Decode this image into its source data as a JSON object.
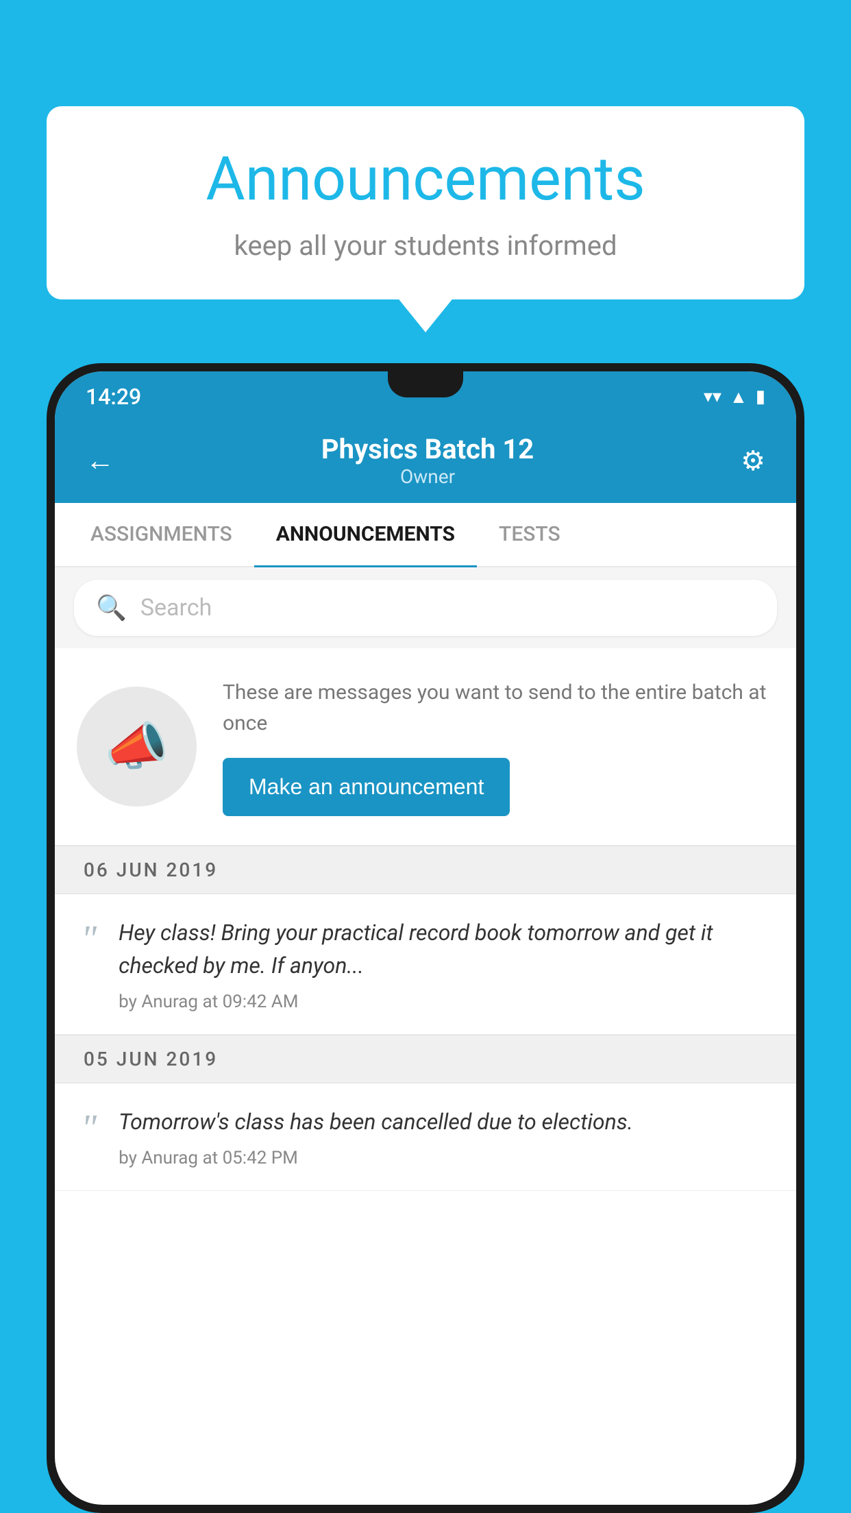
{
  "page": {
    "background_color": "#1DB8E8"
  },
  "speech_bubble": {
    "title": "Announcements",
    "subtitle": "keep all your students informed"
  },
  "status_bar": {
    "time": "14:29"
  },
  "app_header": {
    "batch_name": "Physics Batch 12",
    "role": "Owner",
    "back_label": "←",
    "settings_label": "⚙"
  },
  "tabs": [
    {
      "label": "ASSIGNMENTS",
      "active": false
    },
    {
      "label": "ANNOUNCEMENTS",
      "active": true
    },
    {
      "label": "TESTS",
      "active": false
    }
  ],
  "search": {
    "placeholder": "Search"
  },
  "announcement_cta": {
    "description": "These are messages you want to send to the entire batch at once",
    "button_label": "Make an announcement"
  },
  "announcements": [
    {
      "date": "06  JUN  2019",
      "text": "Hey class! Bring your practical record book tomorrow and get it checked by me. If anyon...",
      "meta": "by Anurag at 09:42 AM"
    },
    {
      "date": "05  JUN  2019",
      "text": "Tomorrow's class has been cancelled due to elections.",
      "meta": "by Anurag at 05:42 PM"
    }
  ]
}
